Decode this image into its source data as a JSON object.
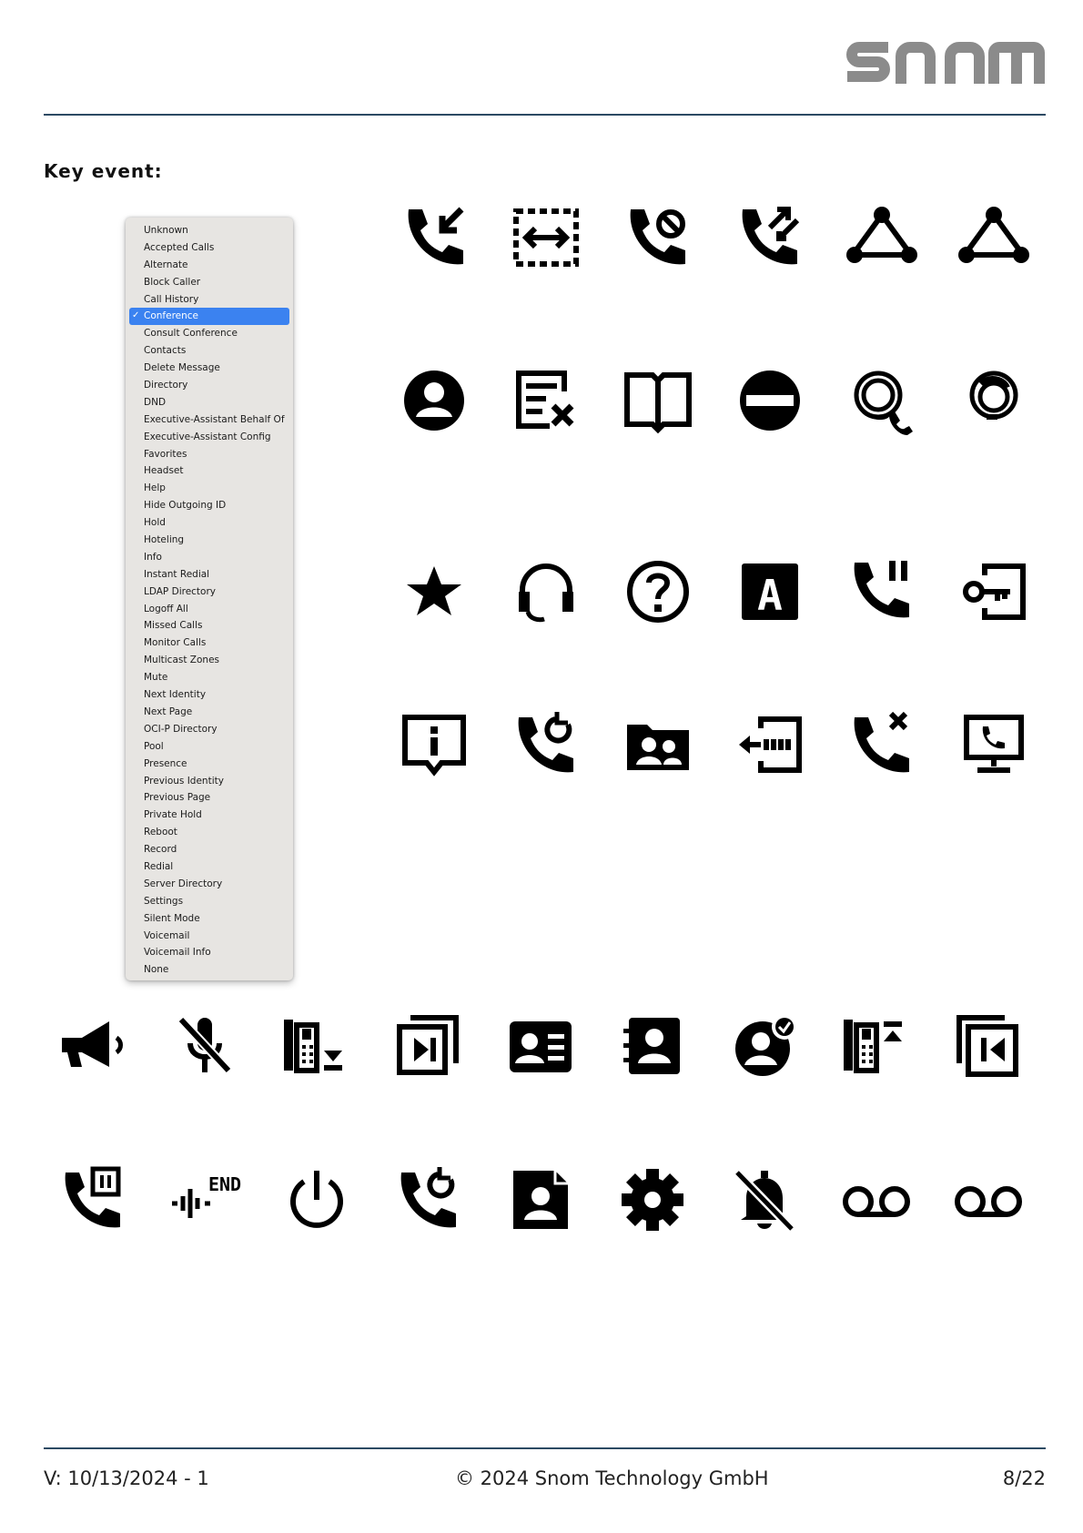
{
  "header": {
    "logo_text": "snom"
  },
  "section": {
    "heading": "Key event:"
  },
  "dropdown": {
    "selected": "Conference",
    "options": [
      "Unknown",
      "Accepted Calls",
      "Alternate",
      "Block Caller",
      "Call History",
      "Conference",
      "Consult Conference",
      "Contacts",
      "Delete Message",
      "Directory",
      "DND",
      "Executive-Assistant Behalf Of",
      "Executive-Assistant Config",
      "Favorites",
      "Headset",
      "Help",
      "Hide Outgoing ID",
      "Hold",
      "Hoteling",
      "Info",
      "Instant Redial",
      "LDAP Directory",
      "Logoff All",
      "Missed Calls",
      "Monitor Calls",
      "Multicast Zones",
      "Mute",
      "Next Identity",
      "Next Page",
      "OCI-P Directory",
      "Pool",
      "Presence",
      "Previous Identity",
      "Previous Page",
      "Private Hold",
      "Reboot",
      "Record",
      "Redial",
      "Server Directory",
      "Settings",
      "Silent Mode",
      "Voicemail",
      "Voicemail Info",
      "None"
    ]
  },
  "icons": {
    "names": [
      "accepted-calls-icon",
      "alternate-icon",
      "block-caller-icon",
      "call-history-icon",
      "conference-icon",
      "consult-conference-icon",
      "contacts-icon",
      "delete-message-icon",
      "directory-icon",
      "dnd-icon",
      "executive-assistant-behalf-icon",
      "executive-assistant-config-icon",
      "favorites-icon",
      "headset-icon",
      "help-icon",
      "hide-outgoing-id-icon",
      "hold-icon",
      "hoteling-icon",
      "info-icon",
      "instant-redial-icon",
      "ldap-directory-icon",
      "logoff-all-icon",
      "missed-calls-icon",
      "monitor-calls-icon",
      "multicast-zones-icon",
      "mute-icon",
      "next-identity-icon",
      "next-page-icon",
      "oci-p-directory-icon",
      "pool-icon",
      "presence-icon",
      "previous-identity-icon",
      "previous-page-icon",
      "private-hold-icon",
      "record-icon",
      "reboot-icon",
      "redial-icon",
      "server-directory-icon",
      "settings-icon",
      "silent-mode-icon",
      "voicemail-icon",
      "voicemail-info-icon"
    ],
    "record_label": "END",
    "id_badge": "A"
  },
  "footer": {
    "version": "V: 10/13/2024 - 1",
    "copyright": "© 2024 Snom Technology GmbH",
    "page": "8/22"
  }
}
